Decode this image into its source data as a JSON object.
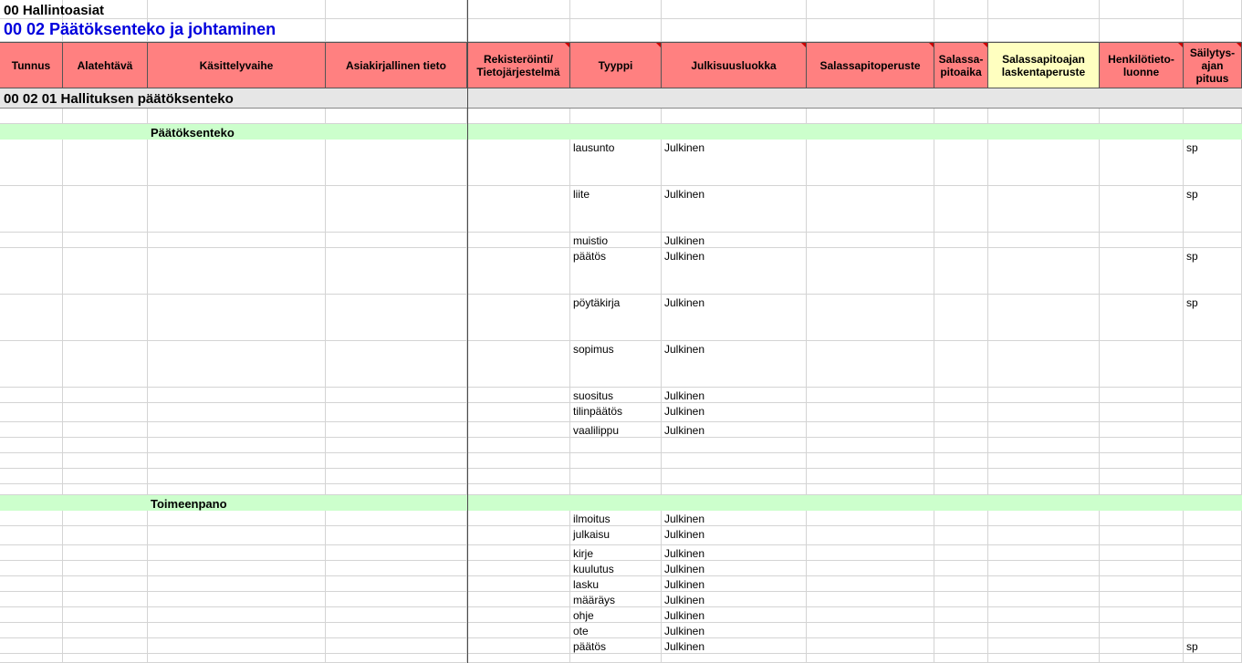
{
  "sheet": {
    "title": "00 Hallintoasiat",
    "subtitle": "00 02 Päätöksenteko ja johtaminen"
  },
  "headers": [
    {
      "label": "Tunnus",
      "name": "tunnus"
    },
    {
      "label": "Alatehtävä",
      "name": "alatehtava"
    },
    {
      "label": "Käsittelyvaihe",
      "name": "kasittelyvaihe"
    },
    {
      "label": "Asiakirjallinen tieto",
      "name": "asiakirjallinen-tieto"
    },
    {
      "label": "Rekisteröinti/\nTietojärjestelmä",
      "name": "rekisterointi",
      "comment": true
    },
    {
      "label": "Tyyppi",
      "name": "tyyppi",
      "comment": true
    },
    {
      "label": "Julkisuusluokka",
      "name": "julkisuusluokka",
      "comment": true
    },
    {
      "label": "Salassapitoperuste",
      "name": "salassapitoperuste",
      "comment": true
    },
    {
      "label": "Salassa-\npitoaika",
      "name": "salassapitoaika",
      "comment": true
    },
    {
      "label": "Salassapitoajan\nlaskentaperuste",
      "name": "laskentaperuste",
      "color": "yellow"
    },
    {
      "label": "Henkilötieto-\nluonne",
      "name": "henkilotietoluonne",
      "comment": true
    },
    {
      "label": "Säilytys-\najan\npituus",
      "name": "sailytysajan-pituus",
      "comment": true
    }
  ],
  "section": {
    "label": "00 02 01  Hallituksen päätöksenteko"
  },
  "phases": [
    {
      "label": "Päätöksenteko",
      "records": [
        {
          "tyyppi": "lausunto",
          "julkisuus": "Julkinen",
          "sailytys": "sp"
        },
        {
          "tyyppi": "liite",
          "julkisuus": "Julkinen",
          "sailytys": "sp"
        },
        {
          "tyyppi": "muistio",
          "julkisuus": "Julkinen",
          "sailytys": ""
        },
        {
          "tyyppi": "päätös",
          "julkisuus": "Julkinen",
          "sailytys": "sp"
        },
        {
          "tyyppi": "pöytäkirja",
          "julkisuus": "Julkinen",
          "sailytys": "sp"
        },
        {
          "tyyppi": "sopimus",
          "julkisuus": "Julkinen",
          "sailytys": ""
        },
        {
          "tyyppi": "suositus",
          "julkisuus": "Julkinen",
          "sailytys": ""
        },
        {
          "tyyppi": "tilinpäätös",
          "julkisuus": "Julkinen",
          "sailytys": ""
        },
        {
          "tyyppi": "vaalilippu",
          "julkisuus": "Julkinen",
          "sailytys": ""
        }
      ]
    },
    {
      "label": "Toimeenpano",
      "records": [
        {
          "tyyppi": "ilmoitus",
          "julkisuus": "Julkinen",
          "sailytys": ""
        },
        {
          "tyyppi": "julkaisu",
          "julkisuus": "Julkinen",
          "sailytys": ""
        },
        {
          "tyyppi": "kirje",
          "julkisuus": "Julkinen",
          "sailytys": ""
        },
        {
          "tyyppi": "kuulutus",
          "julkisuus": "Julkinen",
          "sailytys": ""
        },
        {
          "tyyppi": "lasku",
          "julkisuus": "Julkinen",
          "sailytys": ""
        },
        {
          "tyyppi": "määräys",
          "julkisuus": "Julkinen",
          "sailytys": ""
        },
        {
          "tyyppi": "ohje",
          "julkisuus": "Julkinen",
          "sailytys": ""
        },
        {
          "tyyppi": "ote",
          "julkisuus": "Julkinen",
          "sailytys": ""
        },
        {
          "tyyppi": "päätös",
          "julkisuus": "Julkinen",
          "sailytys": "sp"
        }
      ]
    }
  ],
  "colors": {
    "header": "#ff8080",
    "header_yellow": "#ffffc0",
    "section": "#e6e6e6",
    "phase": "#ccffcc",
    "subtitle": "#0000dd"
  }
}
